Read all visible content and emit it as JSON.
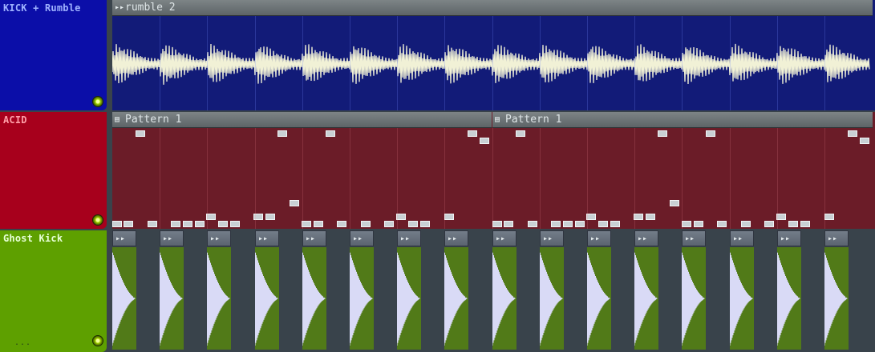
{
  "tracks": [
    {
      "name": "KICK + Rumble",
      "color": "#0b0ea8",
      "name_color": "#9fb2ff"
    },
    {
      "name": "ACID",
      "color": "#a7001c",
      "name_color": "#ff9fa8"
    },
    {
      "name": "Ghost Kick",
      "color": "#5ea000",
      "name_color": "#e7ffd6",
      "more": "..."
    }
  ],
  "rumble_clip": {
    "title": "rumble 2",
    "icon": "audio-clip-icon"
  },
  "acid_clips": [
    {
      "title": "Pattern 1",
      "icon": "pattern-icon"
    },
    {
      "title": "Pattern 1",
      "icon": "pattern-icon"
    }
  ],
  "ghost_kick_clip": {
    "count": 16,
    "icon": "audio-clip-icon"
  },
  "colors": {
    "rumble_bg": "#121b78",
    "waveform": "#f1f1d6",
    "acid_bg": "#6b1c28",
    "kick_wave": "#d9daf6",
    "kick_body": "#517a18"
  }
}
